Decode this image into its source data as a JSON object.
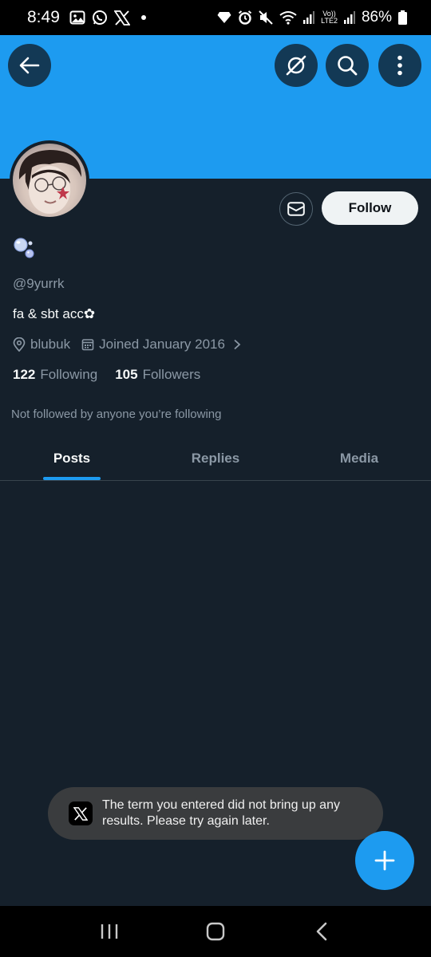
{
  "status_bar": {
    "time": "8:49",
    "network": "LTE2",
    "battery": "86%",
    "left_icons": [
      "gallery-icon",
      "whatsapp-icon",
      "x-icon",
      "dot-icon"
    ],
    "right_icons": [
      "diamond-icon",
      "alarm-icon",
      "mute-icon",
      "wifi-icon",
      "signal-icon",
      "volte-icon",
      "signal-icon",
      "battery-icon"
    ]
  },
  "header": {
    "banner_color": "#1d9bf0",
    "buttons": [
      "back-icon",
      "grok-icon",
      "search-icon",
      "more-icon"
    ]
  },
  "profile": {
    "handle": "@9yurrk",
    "bio": "fa & sbt acc✿",
    "location": "blubuk",
    "joined": "Joined January 2016",
    "following_count": "122",
    "following_label": "Following",
    "followers_count": "105",
    "followers_label": "Followers",
    "not_followed_text": "Not followed by anyone you’re following"
  },
  "actions": {
    "follow_label": "Follow",
    "message_icon": "mail-icon"
  },
  "tabs": [
    {
      "label": "Posts",
      "active": true
    },
    {
      "label": "Replies",
      "active": false
    },
    {
      "label": "Media",
      "active": false
    }
  ],
  "toast": {
    "text": "The term you entered did not bring up any results. Please try again later."
  },
  "colors": {
    "background": "#15202b",
    "accent": "#1d9bf0",
    "secondary_text": "#8b98a5"
  }
}
